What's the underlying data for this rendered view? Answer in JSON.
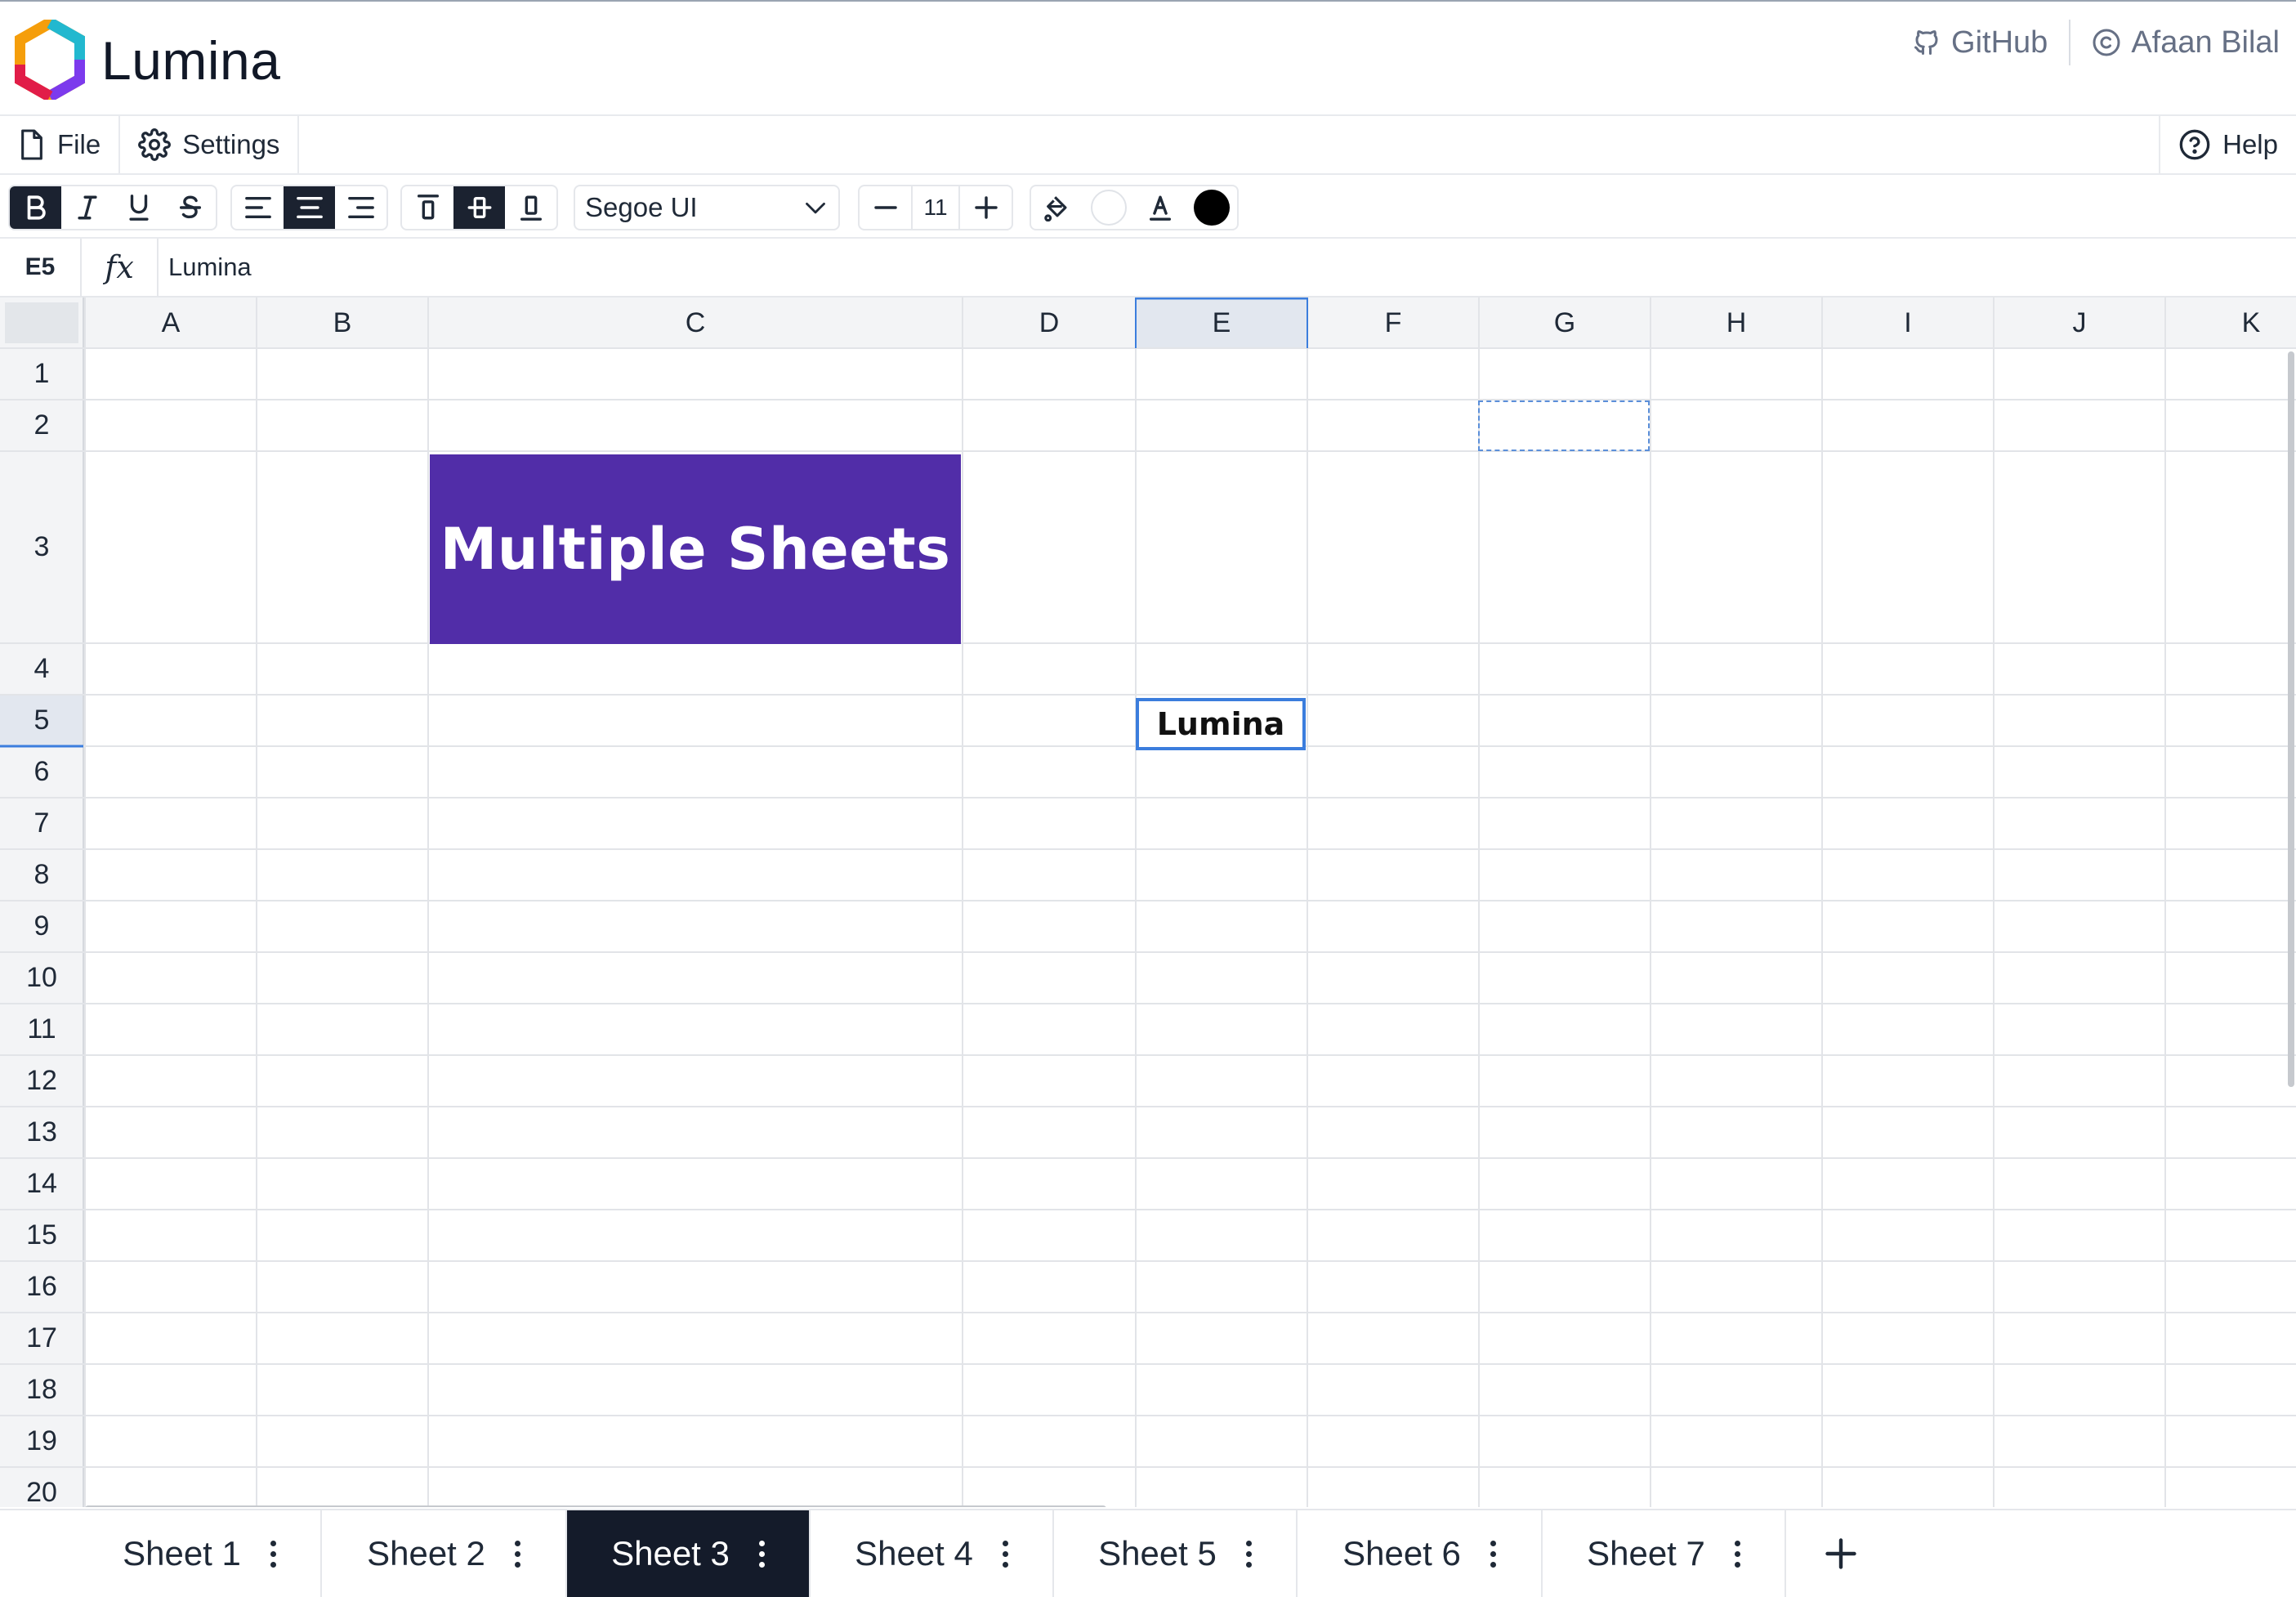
{
  "app": {
    "title": "Lumina"
  },
  "header": {
    "links": [
      {
        "label": "GitHub",
        "icon": "github-icon"
      },
      {
        "label": "Afaan Bilal",
        "icon": "copyright-icon"
      }
    ]
  },
  "menu": {
    "file": "File",
    "settings": "Settings",
    "help": "Help"
  },
  "toolbar": {
    "font_family": "Segoe UI",
    "font_size": "11",
    "active_buttons": [
      "bold",
      "align-center",
      "align-middle"
    ],
    "fill_color": "#ffffff",
    "text_color": "#000000"
  },
  "formula_bar": {
    "cell_ref": "E5",
    "fx": "fx",
    "value": "Lumina"
  },
  "grid": {
    "columns": [
      "A",
      "B",
      "C",
      "D",
      "E",
      "F",
      "G",
      "H",
      "I",
      "J",
      "K"
    ],
    "rows": [
      "1",
      "2",
      "3",
      "4",
      "5",
      "6",
      "7",
      "8",
      "9",
      "10",
      "11",
      "12",
      "13",
      "14",
      "15",
      "16",
      "17",
      "18",
      "19",
      "20"
    ],
    "selected_column": "E",
    "selected_row": "5",
    "cells": {
      "C3": "Multiple Sheets",
      "E5": "Lumina"
    },
    "banner_color": "#512da8",
    "selection_color": "#3b7ddd"
  },
  "sheets": {
    "tabs": [
      "Sheet 1",
      "Sheet 2",
      "Sheet 3",
      "Sheet 4",
      "Sheet 5",
      "Sheet 6",
      "Sheet 7"
    ],
    "active": "Sheet 3"
  }
}
